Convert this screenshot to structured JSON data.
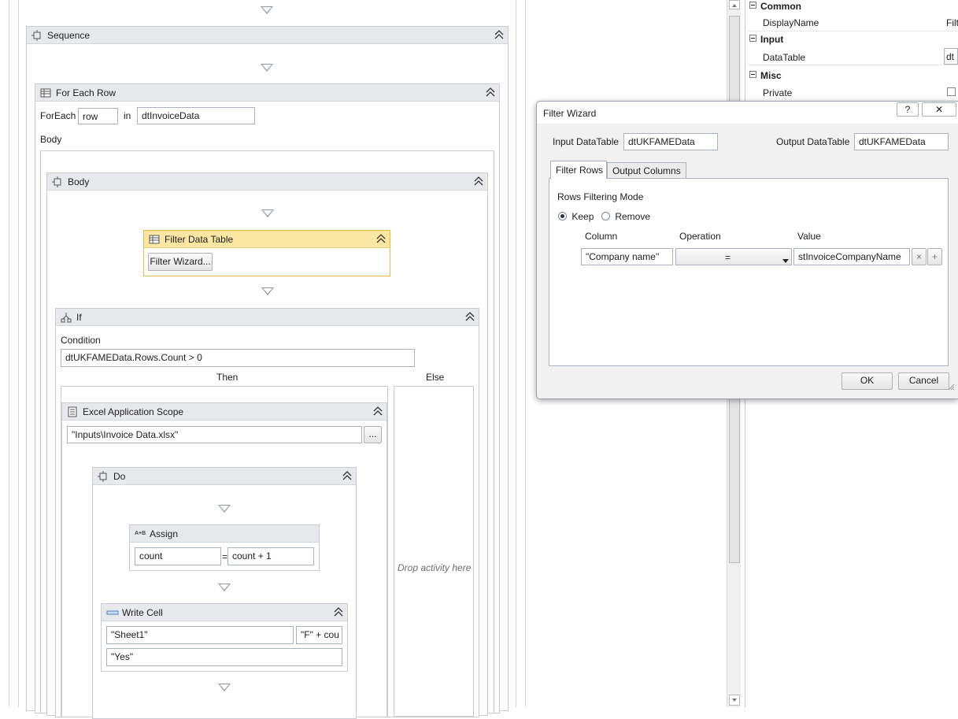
{
  "designer": {
    "sequence": {
      "title": "Sequence"
    },
    "for_each_row": {
      "title": "For Each Row",
      "foreach_label": "ForEach",
      "item_value": "row",
      "in_label": "in",
      "collection_value": "dtInvoiceData",
      "body_label": "Body"
    },
    "body": {
      "title": "Body"
    },
    "filter_data_table": {
      "title": "Filter Data Table",
      "wizard_button": "Filter Wizard..."
    },
    "if": {
      "title": "If",
      "condition_label": "Condition",
      "condition_value": "dtUKFAMEData.Rows.Count > 0",
      "then_label": "Then",
      "else_label": "Else",
      "else_placeholder": "Drop activity here"
    },
    "excel_scope": {
      "title": "Excel Application Scope",
      "path_value": "\"Inputs\\Invoice Data.xlsx\"",
      "browse_button": "..."
    },
    "do": {
      "title": "Do"
    },
    "assign": {
      "title": "Assign",
      "icon_text": "A+B",
      "to_value": "count",
      "equals": "=",
      "value": "count + 1"
    },
    "write_cell": {
      "title": "Write Cell",
      "sheet_value": "\"Sheet1\"",
      "range_value": "\"F\" + cou",
      "value": "\"Yes\""
    }
  },
  "properties": {
    "categories": [
      {
        "name": "Common",
        "rows": [
          {
            "name": "DisplayName",
            "value": "Filt"
          }
        ]
      },
      {
        "name": "Input",
        "rows": [
          {
            "name": "DataTable",
            "value": "dt"
          }
        ]
      },
      {
        "name": "Misc",
        "rows": [
          {
            "name": "Private",
            "value": ""
          }
        ]
      }
    ]
  },
  "dialog": {
    "title": "Filter Wizard",
    "help_button": "?",
    "close_button": "✕",
    "input_label": "Input DataTable",
    "input_value": "dtUKFAMEData",
    "output_label": "Output DataTable",
    "output_value": "dtUKFAMEData",
    "tabs": [
      {
        "label": "Filter Rows",
        "active": true
      },
      {
        "label": "Output Columns",
        "active": false
      }
    ],
    "mode_label": "Rows Filtering Mode",
    "mode_options": [
      {
        "label": "Keep",
        "selected": true
      },
      {
        "label": "Remove",
        "selected": false
      }
    ],
    "columns": [
      "Column",
      "Operation",
      "Value"
    ],
    "row": {
      "column": "\"Company name\"",
      "operation": "=",
      "value": "stInvoiceCompanyName",
      "remove": "×",
      "add": "+"
    },
    "ok_button": "OK",
    "cancel_button": "Cancel"
  },
  "colors": {
    "activity_header": "#e7e9ed",
    "selected_header": "#fbe6a2",
    "selected_border": "#e8b94a",
    "dialog_border": "#9aa3ad",
    "input_border": "#aab3bd"
  }
}
